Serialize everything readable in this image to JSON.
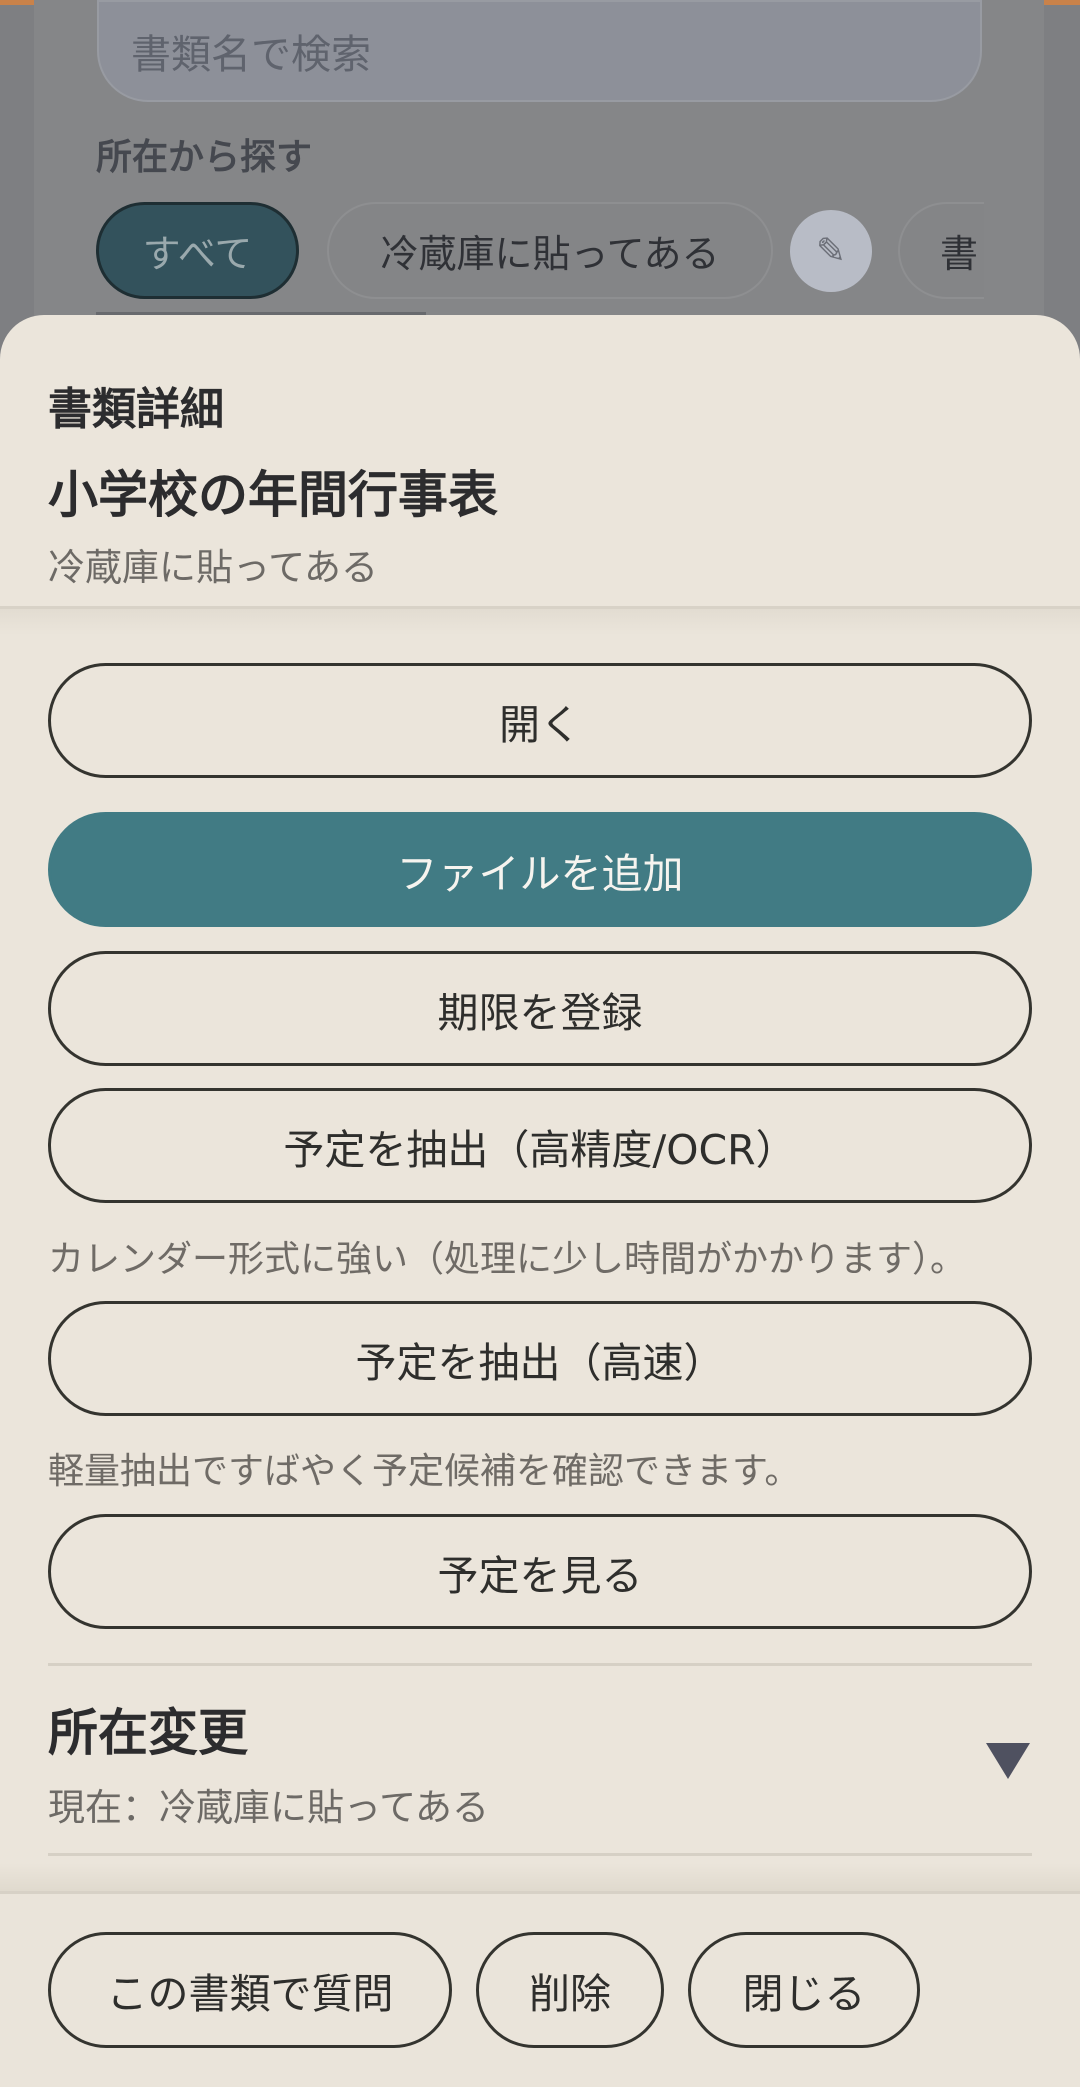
{
  "background": {
    "search_placeholder": "書類名で検索",
    "section_label": "所在から探す",
    "chips": [
      "すべて",
      "冷蔵庫に貼ってある",
      "書"
    ],
    "edit_icon": "pencil-icon"
  },
  "sheet": {
    "kicker": "書類詳細",
    "title": "小学校の年間行事表",
    "subtitle": "冷蔵庫に貼ってある",
    "buttons": {
      "open": "開く",
      "add_file": "ファイルを追加",
      "register_deadline": "期限を登録",
      "extract_ocr": "予定を抽出（高精度/OCR）",
      "extract_fast": "予定を抽出（高速）",
      "view_schedule": "予定を見る"
    },
    "hints": {
      "ocr": "カレンダー形式に強い（処理に少し時間がかかります）。",
      "fast": "軽量抽出ですばやく予定候補を確認できます。"
    },
    "location_change": {
      "title": "所在変更",
      "current": "現在：冷蔵庫に貼ってある",
      "toggle_icon": "triangle-down-icon"
    },
    "footer": {
      "ask": "この書類で質問",
      "delete": "削除",
      "close": "閉じる"
    }
  },
  "colors": {
    "primary": "#417b84",
    "sheet_bg": "#ebe5db",
    "overlay": "#7e7f82",
    "accent_bar": "#c9824a"
  }
}
